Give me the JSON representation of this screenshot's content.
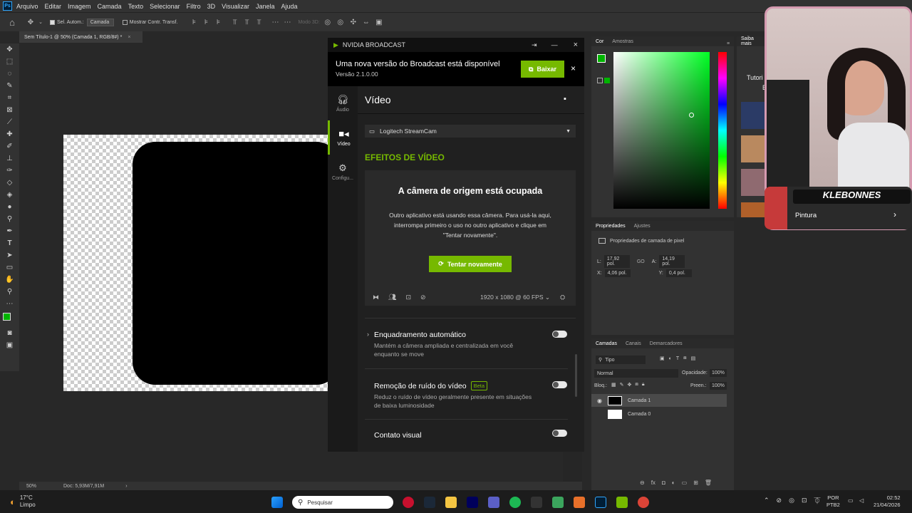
{
  "photoshop": {
    "menu": [
      "Arquivo",
      "Editar",
      "Imagem",
      "Camada",
      "Texto",
      "Selecionar",
      "Filtro",
      "3D",
      "Visualizar",
      "Janela",
      "Ajuda"
    ],
    "logo": "Ps",
    "options": {
      "auto_select": "Sel. Autom.:",
      "auto_select_value": "Camada",
      "show_transform": "Mostrar Contr. Transf.",
      "mode3d": "Modo 3D:"
    },
    "doc_tab": "Sem Título-1 @ 50% (Camada 1, RGB/8#) *",
    "status": {
      "zoom": "50%",
      "doc": "Doc: 5,93M/7,91M"
    },
    "color_panel": {
      "tabs": [
        "Cor",
        "Amostras"
      ],
      "foreground": "#00b400",
      "background": "#0b7fbf"
    },
    "learn_panel": {
      "tab": "Saiba mais",
      "title_partial": "Tutori",
      "title_partial2": "B"
    },
    "properties": {
      "tabs": [
        "Propriedades",
        "Ajustes"
      ],
      "subtitle": "Propriedades de camada de pixel",
      "w_label": "L:",
      "w": "17,92 pol.",
      "h_label": "A:",
      "h": "14,19 pol.",
      "x_label": "X:",
      "x": "4,06 pol.",
      "y_label": "Y:",
      "y": "0,4 pol.",
      "link": "GO"
    },
    "layers": {
      "tabs": [
        "Camadas",
        "Canais",
        "Demarcadores"
      ],
      "filter": "Tipo",
      "blend": "Normal",
      "opacity_label": "Opacidade:",
      "opacity": "100%",
      "lock_label": "Bloq.:",
      "fill_label": "Preen.:",
      "fill": "100%",
      "items": [
        {
          "name": "Camada 1"
        },
        {
          "name": "Camada 0"
        }
      ]
    }
  },
  "broadcast": {
    "title": "NVIDIA BROADCAST",
    "banner_title": "Uma nova versão do Broadcast está disponível",
    "banner_version": "Versão 2.1.0.00",
    "download": "Baixar",
    "side": [
      {
        "label": "Áudio"
      },
      {
        "label": "Vídeo"
      },
      {
        "label": "Configu..."
      }
    ],
    "page_title": "Vídeo",
    "camera": "Logitech StreamCam",
    "section": "EFEITOS DE VÍDEO",
    "busy_title": "A câmera de origem está ocupada",
    "busy_text_1": "Outro aplicativo está usando essa câmera. Para usá-la aqui,",
    "busy_text_2": "interrompa primeiro o uso no outro aplicativo e clique em",
    "busy_text_3": "\"Tentar novamente\".",
    "retry": "Tentar novamente",
    "resolution": "1920 x 1080 @ 60 FPS",
    "effects": [
      {
        "title": "Enquadramento automático",
        "desc1": "Mantém a câmera ampliada e centralizada em você",
        "desc2": "enquanto se move"
      },
      {
        "title": "Remoção de ruído do vídeo",
        "badge": "Beta",
        "desc1": "Reduz o ruído de vídeo geralmente presente em situações",
        "desc2": "de baixa luminosidade"
      },
      {
        "title": "Contato visual"
      }
    ]
  },
  "overlay": {
    "name_tag": "KLEBONNES",
    "label": "Pintura"
  },
  "taskbar": {
    "weather_temp": "17°C",
    "weather_desc": "Limpo",
    "search": "Pesquisar",
    "lang1": "POR",
    "lang2": "PTB2",
    "time": "02:52",
    "date": "21/04/2026"
  }
}
